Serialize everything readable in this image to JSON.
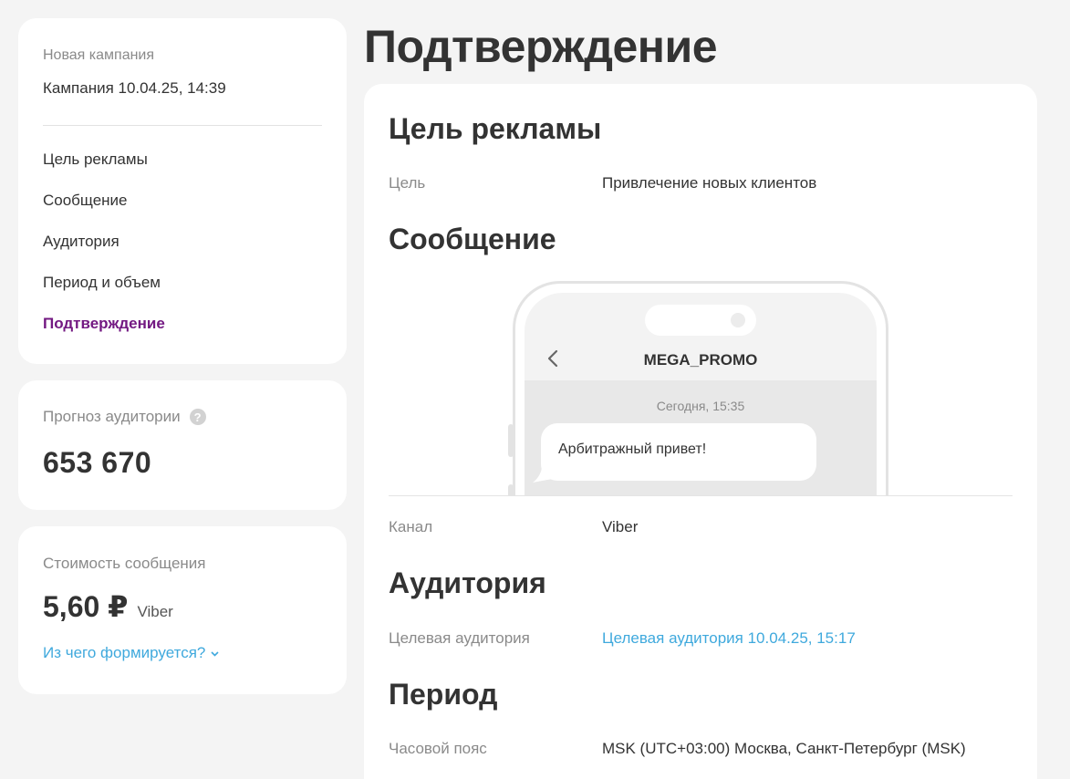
{
  "sidebar": {
    "campaign_label": "Новая кампания",
    "campaign_name": "Кампания 10.04.25, 14:39",
    "steps": [
      {
        "label": "Цель рекламы"
      },
      {
        "label": "Сообщение"
      },
      {
        "label": "Аудитория"
      },
      {
        "label": "Период и объем"
      },
      {
        "label": "Подтверждение"
      }
    ],
    "active_step": "Подтверждение",
    "active_color": "#731982"
  },
  "forecast": {
    "label": "Прогноз аудитории",
    "help_icon": "question-circle-icon",
    "value": "653 670"
  },
  "cost": {
    "label": "Стоимость сообщения",
    "price": "5,60 ₽",
    "channel": "Viber",
    "breakdown_link": "Из чего формируется?",
    "breakdown_icon": "chevron-down-icon",
    "link_color": "#3fa9dd"
  },
  "page": {
    "title": "Подтверждение"
  },
  "summary": {
    "goal_section": {
      "title": "Цель рекламы",
      "label": "Цель",
      "value": "Привлечение новых клиентов"
    },
    "message_section": {
      "title": "Сообщение",
      "preview": {
        "back_icon": "chevron-left-icon",
        "sender": "MEGA_PROMO",
        "time": "Сегодня, 15:35",
        "text": "Арбитражный привет!"
      },
      "channel_label": "Канал",
      "channel_value": "Viber"
    },
    "audience_section": {
      "title": "Аудитория",
      "label": "Целевая аудитория",
      "value": "Целевая аудитория 10.04.25, 15:17"
    },
    "period_section": {
      "title": "Период",
      "label": "Часовой пояс",
      "value": "MSK (UTC+03:00) Москва, Санкт-Петербург (MSK)"
    }
  }
}
